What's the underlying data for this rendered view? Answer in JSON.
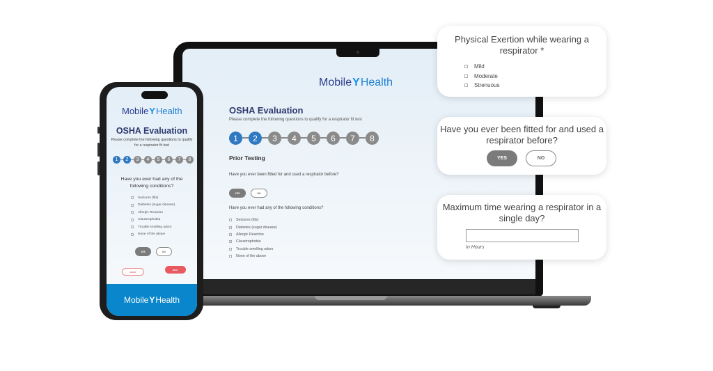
{
  "brand": {
    "logo_left": "Mobile",
    "logo_right": "Health",
    "logo_icon": "person-figure-icon",
    "colors": {
      "navy": "#2e3a6e",
      "blue": "#1d7fd0",
      "step_active": "#2f78c2",
      "step_inactive": "#8a8a8a",
      "next_button": "#e85a5f",
      "footer": "#0a86cc"
    }
  },
  "laptop": {
    "title": "OSHA Evaluation",
    "subtitle": "Please complete the following questions to qualify for a respirator fit test",
    "steps": [
      {
        "label": "1",
        "active": true
      },
      {
        "label": "2",
        "active": true
      },
      {
        "label": "3",
        "active": false
      },
      {
        "label": "4",
        "active": false
      },
      {
        "label": "5",
        "active": false
      },
      {
        "label": "6",
        "active": false
      },
      {
        "label": "7",
        "active": false
      },
      {
        "label": "8",
        "active": false
      }
    ],
    "section": "Prior Testing",
    "question1": "Have you ever been fitted for and used a respirator before?",
    "yes_label": "YES",
    "no_label": "NO",
    "question2": "Have you ever had any of the following conditions?",
    "conditions": [
      "Seizures (fits)",
      "Diabetes (sugar disease)",
      "Allergic Reaction",
      "Claustrophobia",
      "Trouble smelling odors",
      "None of the above"
    ]
  },
  "phone": {
    "title": "OSHA Evaluation",
    "subtitle": "Please complete the following questions to qualify for a respirator fit test",
    "steps": [
      "1",
      "2",
      "3",
      "4",
      "5",
      "6",
      "7",
      "8"
    ],
    "active_steps": 2,
    "question": "Have you ever had any of the following conditions?",
    "conditions": [
      "Seizures (fits)",
      "Diabetes (sugar disease)",
      "Allergic Reaction",
      "Claustrophobia",
      "Trouble smelling odors",
      "None of the above"
    ],
    "yes_label": "YES",
    "no_label": "NO",
    "back_label": "BACK",
    "next_label": "NEXT"
  },
  "cards": {
    "exertion": {
      "title": "Physical Exertion while wearing a respirator *",
      "options": [
        "Mild",
        "Moderate",
        "Strenuous"
      ]
    },
    "fitted": {
      "title": "Have you ever been fitted for and used a respirator before?",
      "yes_label": "YES",
      "no_label": "NO"
    },
    "max_time": {
      "title": "Maximum time wearing a respirator in a single day?",
      "input_value": "",
      "hint": "In Hours"
    }
  }
}
